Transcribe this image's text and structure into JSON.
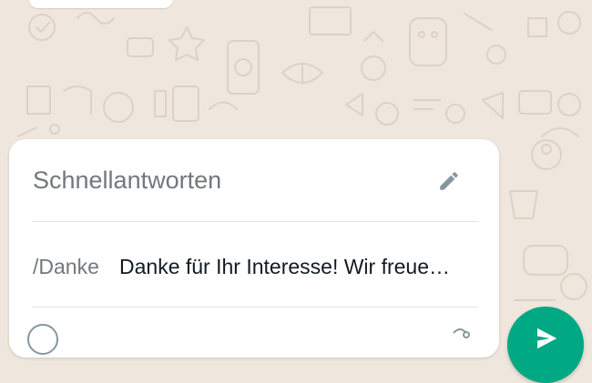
{
  "quick_replies_panel": {
    "title": "Schnellantworten",
    "edit_icon": "pencil-icon",
    "items": [
      {
        "shortcut": "/Danke",
        "message": "Danke für Ihr Interesse! Wir freue…"
      }
    ]
  },
  "icons": {
    "edit": "pencil-icon",
    "send": "send-icon"
  },
  "colors": {
    "wallpaper": "#efe7dd",
    "accent": "#00a884",
    "muted_text": "#72787c",
    "primary_text": "#111b21"
  }
}
